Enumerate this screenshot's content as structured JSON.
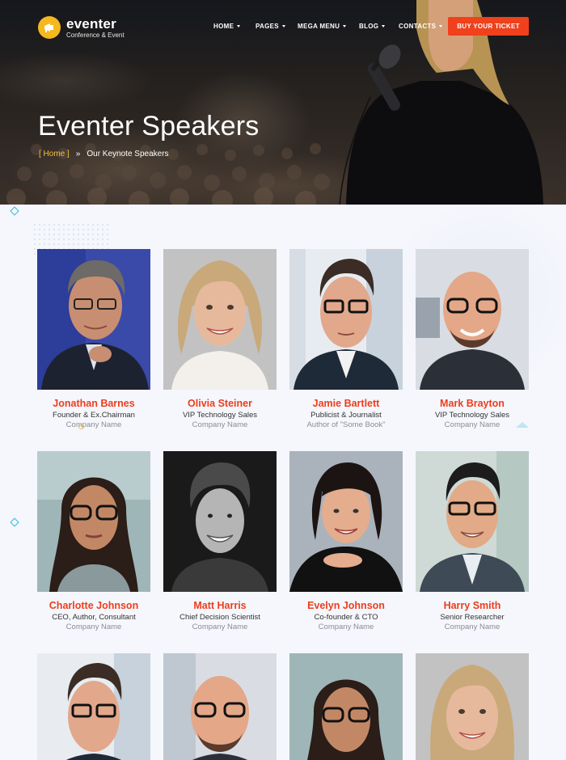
{
  "brand": {
    "name": "eventer",
    "tagline": "Conference & Event"
  },
  "nav": {
    "items": [
      {
        "label": "HOME"
      },
      {
        "label": "PAGES"
      },
      {
        "label": "MEGA MENU"
      },
      {
        "label": "BLOG"
      },
      {
        "label": "CONTACTS"
      }
    ],
    "cta": "BUY YOUR TICKET"
  },
  "hero": {
    "title": "Eventer Speakers",
    "breadcrumb": {
      "home": "[ Home ]",
      "separator": "»",
      "current": "Our Keynote Speakers"
    }
  },
  "colors": {
    "accent": "#ee3d1c",
    "cta": "#f0401c",
    "logo": "#f5b81e"
  },
  "speakers": [
    {
      "name": "Jonathan Barnes",
      "role": "Founder & Ex.Chairman",
      "company": "Company Name"
    },
    {
      "name": "Olivia Steiner",
      "role": "VIP Technology Sales",
      "company": "Company Name"
    },
    {
      "name": "Jamie Bartlett",
      "role": "Publicist & Journalist",
      "company": "Author of \"Some Book\""
    },
    {
      "name": "Mark Brayton",
      "role": "VIP Technology Sales",
      "company": "Company Name"
    },
    {
      "name": "Charlotte Johnson",
      "role": "CEO, Author, Consultant",
      "company": "Company Name"
    },
    {
      "name": "Matt Harris",
      "role": "Chief Decision Scientist",
      "company": "Company Name"
    },
    {
      "name": "Evelyn Johnson",
      "role": "Co-founder & CTO",
      "company": "Company Name"
    },
    {
      "name": "Harry Smith",
      "role": "Senior Researcher",
      "company": "Company Name"
    },
    {
      "name": "",
      "role": "",
      "company": ""
    },
    {
      "name": "",
      "role": "",
      "company": ""
    },
    {
      "name": "",
      "role": "",
      "company": ""
    },
    {
      "name": "",
      "role": "",
      "company": ""
    }
  ]
}
